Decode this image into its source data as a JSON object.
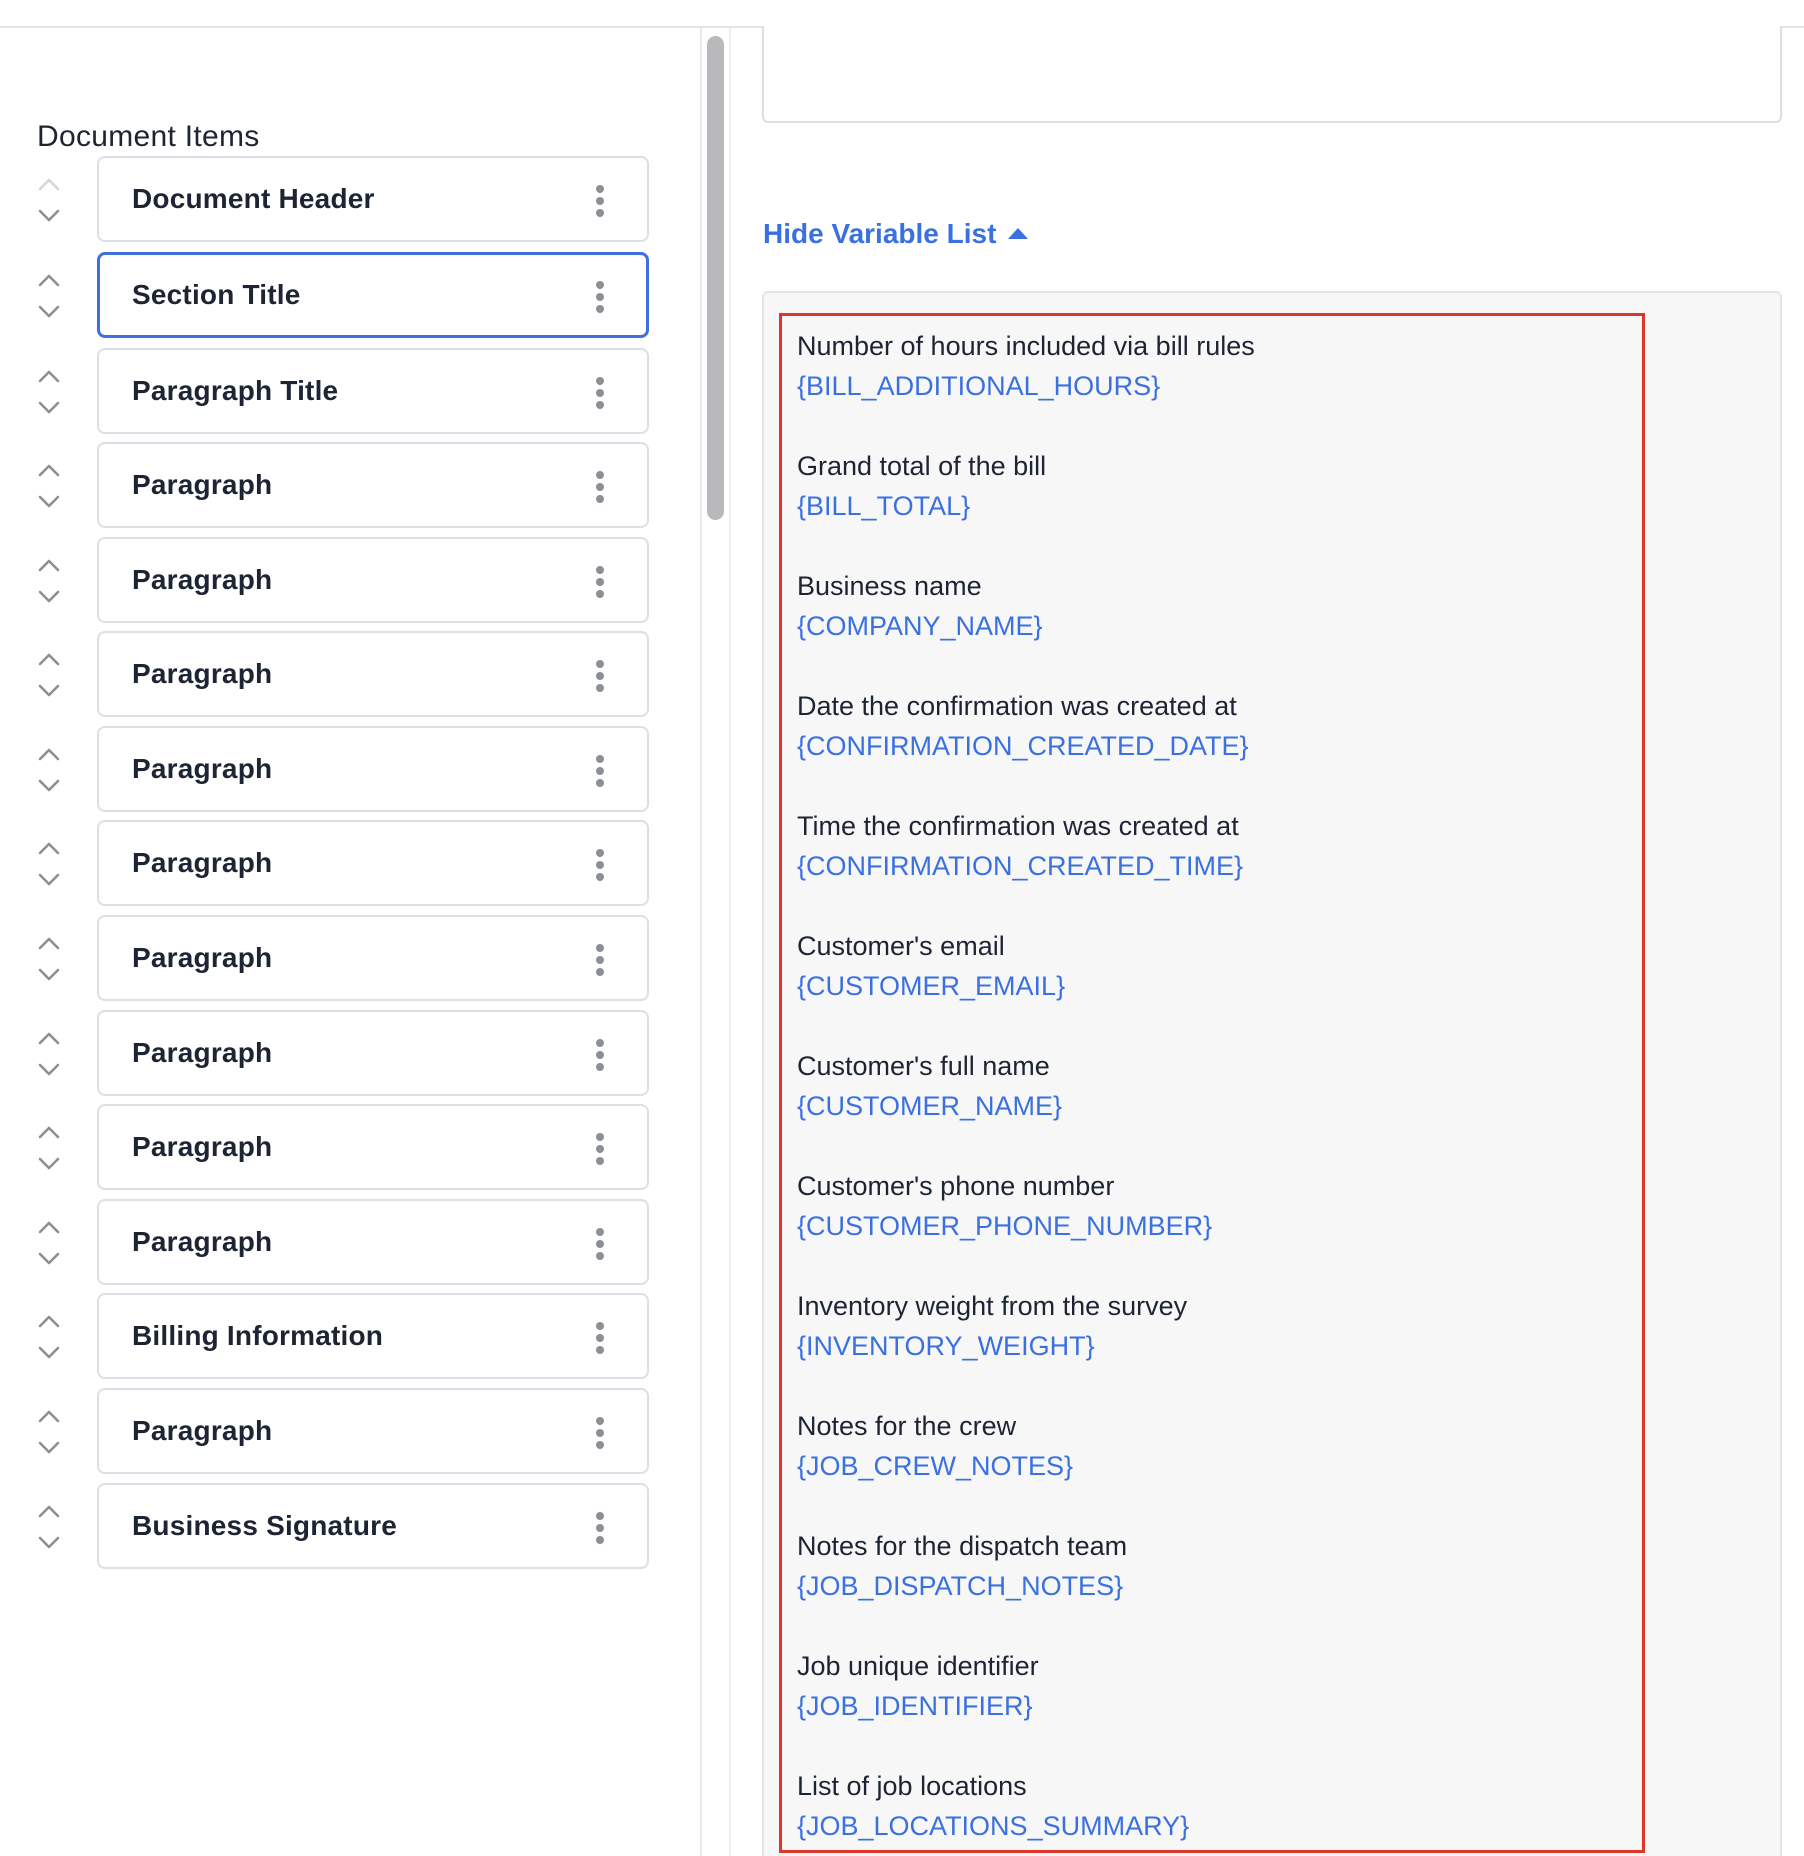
{
  "left_panel": {
    "title": "Document Items",
    "items": [
      {
        "label": "Document Header",
        "selected": false,
        "can_move_up": false
      },
      {
        "label": "Section Title",
        "selected": true,
        "can_move_up": true
      },
      {
        "label": "Paragraph Title",
        "selected": false,
        "can_move_up": true
      },
      {
        "label": "Paragraph",
        "selected": false,
        "can_move_up": true
      },
      {
        "label": "Paragraph",
        "selected": false,
        "can_move_up": true
      },
      {
        "label": "Paragraph",
        "selected": false,
        "can_move_up": true
      },
      {
        "label": "Paragraph",
        "selected": false,
        "can_move_up": true
      },
      {
        "label": "Paragraph",
        "selected": false,
        "can_move_up": true
      },
      {
        "label": "Paragraph",
        "selected": false,
        "can_move_up": true
      },
      {
        "label": "Paragraph",
        "selected": false,
        "can_move_up": true
      },
      {
        "label": "Paragraph",
        "selected": false,
        "can_move_up": true
      },
      {
        "label": "Paragraph",
        "selected": false,
        "can_move_up": true
      },
      {
        "label": "Billing Information",
        "selected": false,
        "can_move_up": true
      },
      {
        "label": "Paragraph",
        "selected": false,
        "can_move_up": true
      },
      {
        "label": "Business Signature",
        "selected": false,
        "can_move_up": true
      }
    ],
    "icons": {
      "move_up": "chevron-up-icon",
      "move_down": "chevron-down-icon",
      "options": "more-vertical-icon"
    }
  },
  "right_panel": {
    "variable_toggle": {
      "label": "Hide Variable List",
      "icon": "caret-up-icon"
    },
    "variables": [
      {
        "description": "Number of hours included via bill rules",
        "token": "{BILL_ADDITIONAL_HOURS}"
      },
      {
        "description": "Grand total of the bill",
        "token": "{BILL_TOTAL}"
      },
      {
        "description": "Business name",
        "token": "{COMPANY_NAME}"
      },
      {
        "description": "Date the confirmation was created at",
        "token": "{CONFIRMATION_CREATED_DATE}"
      },
      {
        "description": "Time the confirmation was created at",
        "token": "{CONFIRMATION_CREATED_TIME}"
      },
      {
        "description": "Customer's email",
        "token": "{CUSTOMER_EMAIL}"
      },
      {
        "description": "Customer's full name",
        "token": "{CUSTOMER_NAME}"
      },
      {
        "description": "Customer's phone number",
        "token": "{CUSTOMER_PHONE_NUMBER}"
      },
      {
        "description": "Inventory weight from the survey",
        "token": "{INVENTORY_WEIGHT}"
      },
      {
        "description": "Notes for the crew",
        "token": "{JOB_CREW_NOTES}"
      },
      {
        "description": "Notes for the dispatch team",
        "token": "{JOB_DISPATCH_NOTES}"
      },
      {
        "description": "Job unique identifier",
        "token": "{JOB_IDENTIFIER}"
      },
      {
        "description": "List of job locations",
        "token": "{JOB_LOCATIONS_SUMMARY}"
      }
    ]
  },
  "colors": {
    "accent": "#3a70e0",
    "selected_border": "#3f6fe0",
    "highlight": "#e0352b",
    "text": "#1d2433",
    "card_border": "#dcdfe4"
  }
}
